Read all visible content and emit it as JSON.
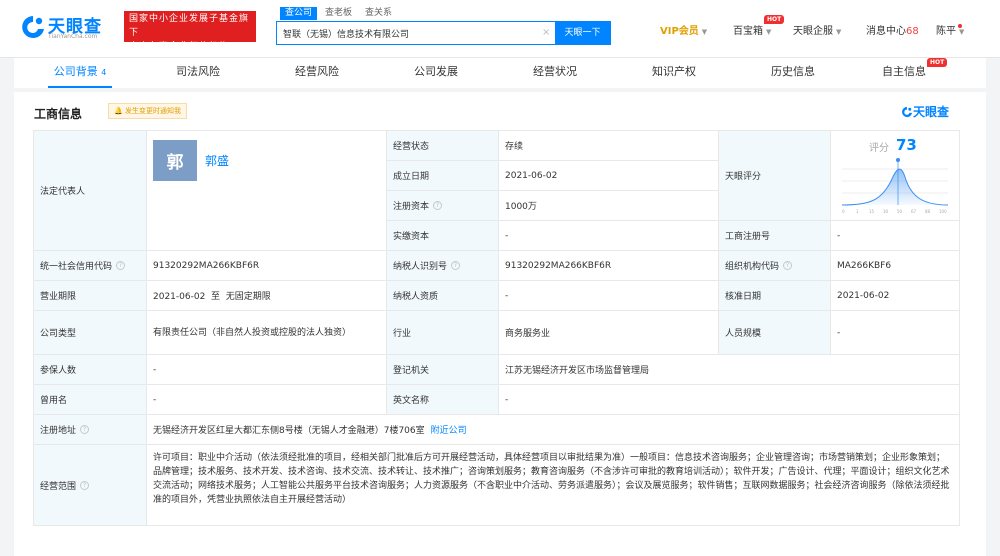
{
  "header": {
    "logo_title": "天眼查",
    "logo_sub": "TianYanCha.com",
    "promo_line1": "国家中小企业发展子基金旗下",
    "promo_line2": "官方备案企业征信机构",
    "search_tabs": [
      "查公司",
      "查老板",
      "查关系"
    ],
    "search_value": "智联（无锡）信息技术有限公司",
    "search_clear": "×",
    "search_button": "天眼一下",
    "nav": {
      "vip": "VIP会员",
      "baibaoxiang": "百宝箱",
      "hot_badge": "HOT",
      "qifu": "天眼企服",
      "messages": "消息中心",
      "messages_count": "68",
      "user": "陈平"
    }
  },
  "tabs": [
    {
      "label": "公司背景",
      "count": "4"
    },
    {
      "label": "司法风险"
    },
    {
      "label": "经营风险"
    },
    {
      "label": "公司发展"
    },
    {
      "label": "经营状况"
    },
    {
      "label": "知识产权"
    },
    {
      "label": "历史信息"
    },
    {
      "label": "自主信息",
      "badge": "HOT"
    }
  ],
  "section": {
    "title": "工商信息",
    "notice": "发生变更时通知我",
    "brand": "天眼查"
  },
  "info": {
    "legal_rep_label": "法定代表人",
    "legal_rep_avatar": "郭",
    "legal_rep_name": "郭盛",
    "status_label": "经营状态",
    "status_value": "存续",
    "established_label": "成立日期",
    "established_value": "2021-06-02",
    "reg_capital_label": "注册资本",
    "reg_capital_value": "1000万",
    "paid_capital_label": "实缴资本",
    "paid_capital_value": "-",
    "score_label_cell": "天眼评分",
    "score_title": "评分",
    "score_value": "73",
    "score_axis": [
      "0",
      "1",
      "15",
      "30",
      "50",
      "67",
      "88",
      "100"
    ],
    "biz_reg_no_label": "工商注册号",
    "biz_reg_no_value": "-",
    "credit_code_label": "统一社会信用代码",
    "credit_code_value": "91320292MA266KBF6R",
    "taxpayer_id_label": "纳税人识别号",
    "taxpayer_id_value": "91320292MA266KBF6R",
    "org_code_label": "组织机构代码",
    "org_code_value": "MA266KBF6",
    "term_label": "营业期限",
    "term_value": "2021-06-02  至  无固定期限",
    "taxpayer_qual_label": "纳税人资质",
    "taxpayer_qual_value": "-",
    "approved_date_label": "核准日期",
    "approved_date_value": "2021-06-02",
    "company_type_label": "公司类型",
    "company_type_value": "有限责任公司（非自然人投资或控股的法人独资）",
    "industry_label": "行业",
    "industry_value": "商务服务业",
    "staff_size_label": "人员规模",
    "staff_size_value": "-",
    "insured_label": "参保人数",
    "insured_value": "-",
    "registry_label": "登记机关",
    "registry_value": "江苏无锡经济开发区市场监督管理局",
    "former_name_label": "曾用名",
    "former_name_value": "-",
    "english_name_label": "英文名称",
    "english_name_value": "-",
    "address_label": "注册地址",
    "address_value": "无锡经济开发区红星大都汇东侧8号楼（无锡人才金融港）7楼706室",
    "address_link": "附近公司",
    "scope_label": "经营范围",
    "scope_value": "许可项目：职业中介活动（依法须经批准的项目，经相关部门批准后方可开展经营活动，具体经营项目以审批结果为准）一般项目：信息技术咨询服务；企业管理咨询；市场营销策划；企业形象策划；品牌管理；技术服务、技术开发、技术咨询、技术交流、技术转让、技术推广；咨询策划服务；教育咨询服务（不含涉许可审批的教育培训活动）；软件开发；广告设计、代理；平面设计；组织文化艺术交流活动；网络技术服务；人工智能公共服务平台技术咨询服务；人力资源服务（不含职业中介活动、劳务派遣服务）；会议及展览服务；软件销售；互联网数据服务；社会经济咨询服务（除依法须经批准的项目外，凭营业执照依法自主开展经营活动）"
  },
  "colors": {
    "brand_blue": "#0084ff",
    "promo_red": "#e02020",
    "label_bg": "#f2f9fc",
    "vip_gold": "#e0a000"
  }
}
